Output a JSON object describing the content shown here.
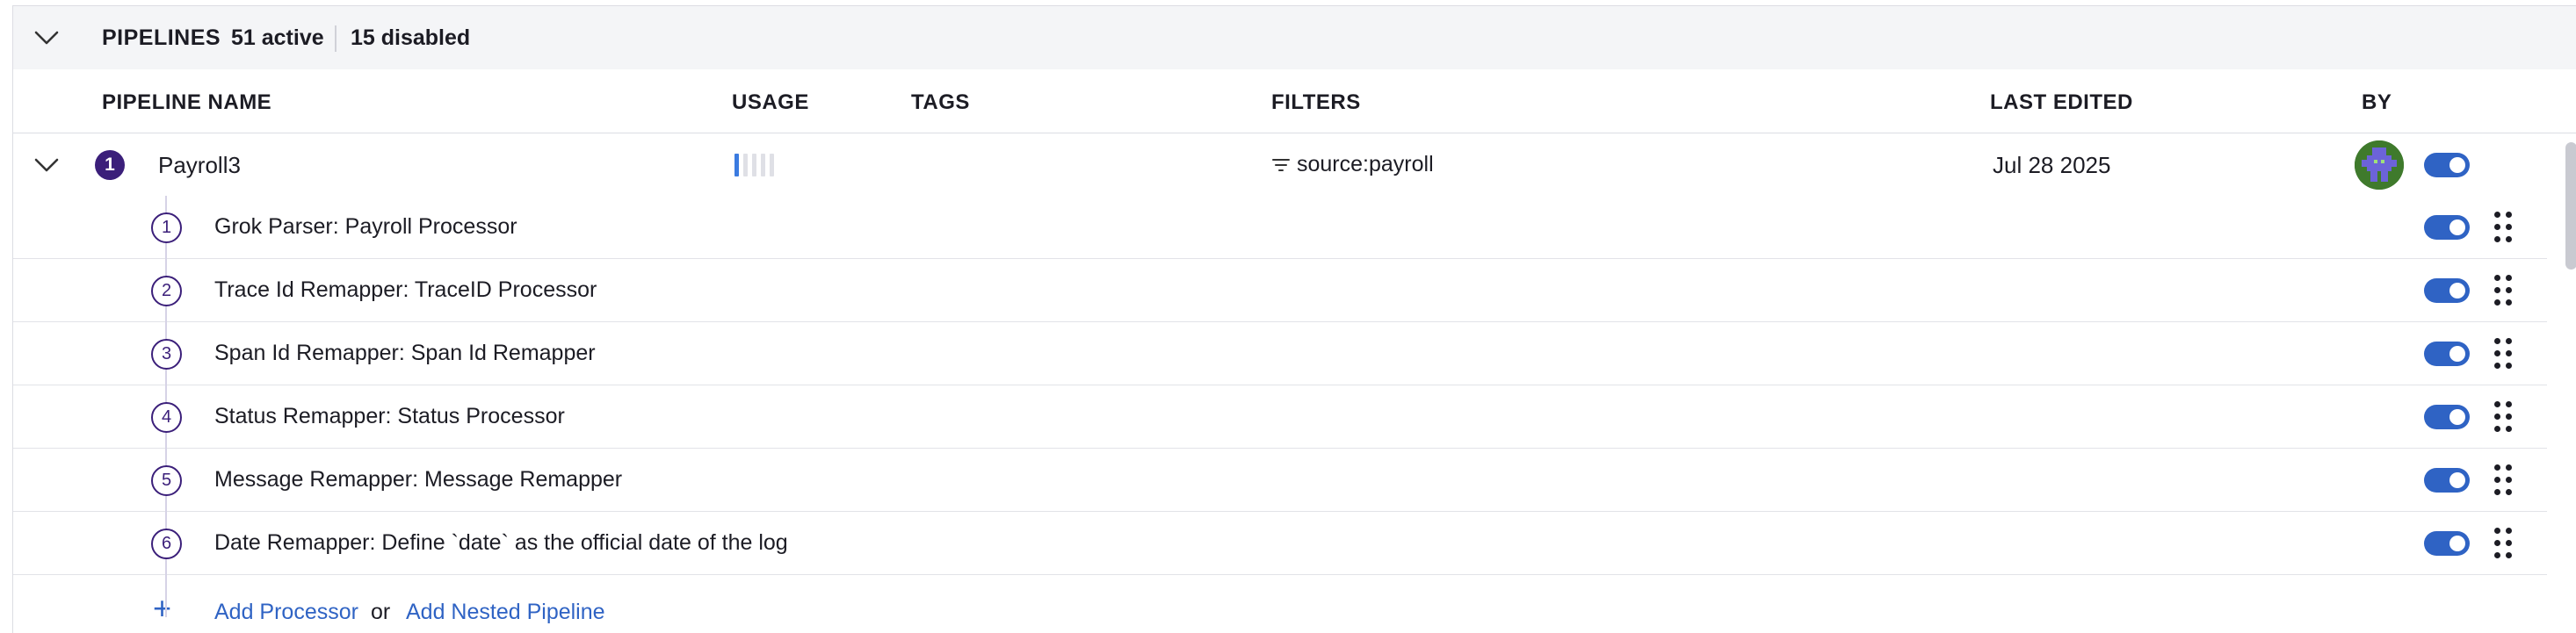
{
  "group": {
    "title": "PIPELINES",
    "active": "51 active",
    "disabled": "15 disabled"
  },
  "columns": {
    "name": "PIPELINE NAME",
    "usage": "USAGE",
    "tags": "TAGS",
    "filters": "FILTERS",
    "last_edited": "LAST EDITED",
    "by": "BY"
  },
  "pipeline": {
    "index": "1",
    "name": "Payroll3",
    "usage_level": 0.2,
    "filter": "source:payroll",
    "last_edited": "Jul 28 2025",
    "enabled": true
  },
  "processors": [
    {
      "index": "1",
      "name": "Grok Parser: Payroll Processor",
      "enabled": true
    },
    {
      "index": "2",
      "name": "Trace Id Remapper: TraceID Processor",
      "enabled": true
    },
    {
      "index": "3",
      "name": "Span Id Remapper: Span Id Remapper",
      "enabled": true
    },
    {
      "index": "4",
      "name": "Status Remapper: Status Processor",
      "enabled": true
    },
    {
      "index": "5",
      "name": "Message Remapper: Message Remapper",
      "enabled": true
    },
    {
      "index": "6",
      "name": "Date Remapper: Define `date` as the official date of the log",
      "enabled": true
    }
  ],
  "add": {
    "plus": "+",
    "processor": "Add Processor",
    "or": "or",
    "nested": "Add Nested Pipeline"
  },
  "colors": {
    "accent": "#2f63c4",
    "badge": "#3b1f7a",
    "header_bg": "#f4f5f7"
  },
  "icons": {
    "collapse": "chevron-down-icon",
    "filter": "filter-icon",
    "drag": "drag-handle-icon",
    "avatar": "user-avatar"
  }
}
